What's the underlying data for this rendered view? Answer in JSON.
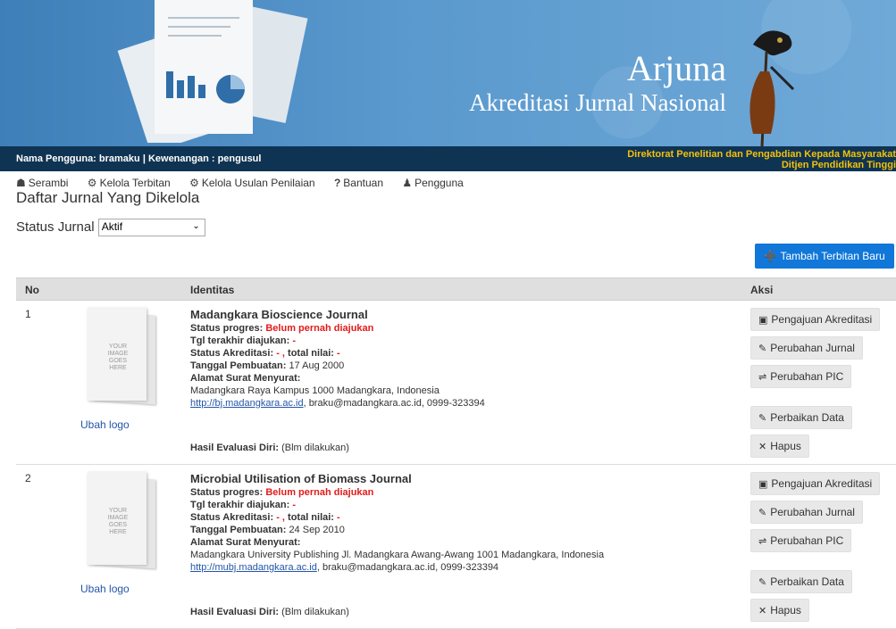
{
  "banner": {
    "title": "Arjuna",
    "subtitle": "Akreditasi Jurnal Nasional"
  },
  "userbar": {
    "user_text": "Nama Pengguna: bramaku | Kewenangan : pengusul",
    "directorate_line1": "Direktorat Penelitian dan Pengabdian Kepada Masyarakat",
    "directorate_line2": "Ditjen Pendidikan Tinggi"
  },
  "nav": {
    "items": [
      {
        "label": "Serambi",
        "icon": "home-icon"
      },
      {
        "label": "Kelola Terbitan",
        "icon": "gear-icon"
      },
      {
        "label": "Kelola Usulan Penilaian",
        "icon": "gear-icon"
      },
      {
        "label": "Bantuan",
        "icon": "question-icon"
      },
      {
        "label": "Pengguna",
        "icon": "user-icon"
      }
    ]
  },
  "page": {
    "title": "Daftar Jurnal Yang Dikelola",
    "status_label": "Status Jurnal",
    "status_value": "Aktif",
    "add_button": "Tambah Terbitan Baru"
  },
  "table": {
    "headers": {
      "no": "No",
      "identitas": "Identitas",
      "aksi": "Aksi"
    },
    "rows": [
      {
        "no": "1",
        "title": "Madangkara Bioscience Journal",
        "status_progres_label": "Status progres:",
        "status_progres_value": "Belum pernah diajukan",
        "tgl_label": "Tgl terakhir diajukan:",
        "tgl_value": "-",
        "akreditasi_label": "Status Akreditasi:",
        "akreditasi_value": "- ,",
        "nilai_label": "total nilai:",
        "nilai_value": "-",
        "pembuatan_label": "Tanggal Pembuatan:",
        "pembuatan_value": "17 Aug 2000",
        "alamat_label": "Alamat Surat Menyurat:",
        "alamat_value": "Madangkara Raya Kampus 1000 Madangkara, Indonesia",
        "url": "http://bj.madangkara.ac.id",
        "contact": ", braku@madangkara.ac.id, 0999-323394",
        "eval_label": "Hasil Evaluasi Diri:",
        "eval_value": "(Blm dilakukan)",
        "ubah_logo": "Ubah logo"
      },
      {
        "no": "2",
        "title": "Microbial Utilisation of Biomass Journal",
        "status_progres_label": "Status progres:",
        "status_progres_value": "Belum pernah diajukan",
        "tgl_label": "Tgl terakhir diajukan:",
        "tgl_value": "-",
        "akreditasi_label": "Status Akreditasi:",
        "akreditasi_value": "- ,",
        "nilai_label": "total nilai:",
        "nilai_value": "-",
        "pembuatan_label": "Tanggal Pembuatan:",
        "pembuatan_value": "24 Sep 2010",
        "alamat_label": "Alamat Surat Menyurat:",
        "alamat_value": "Madangkara University Publishing Jl. Madangkara Awang-Awang 1001 Madangkara, Indonesia",
        "url": "http://mubj.madangkara.ac.id",
        "contact": ", braku@madangkara.ac.id, 0999-323394",
        "eval_label": "Hasil Evaluasi Diri:",
        "eval_value": "(Blm dilakukan)",
        "ubah_logo": "Ubah logo"
      }
    ],
    "actions": {
      "pengajuan": "Pengajuan Akreditasi",
      "perubahan_jurnal": "Perubahan Jurnal",
      "perubahan_pic": "Perubahan PIC",
      "perbaikan": "Perbaikan Data",
      "hapus": "Hapus"
    },
    "thumb_text": "YOUR IMAGE GOES HERE"
  }
}
